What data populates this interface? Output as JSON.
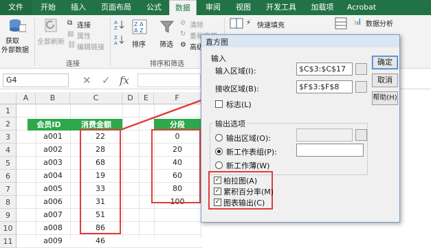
{
  "ribbon": {
    "tabs": [
      "文件",
      "开始",
      "插入",
      "页面布局",
      "公式",
      "数据",
      "审阅",
      "视图",
      "开发工具",
      "加载项",
      "Acrobat"
    ],
    "active_tab": "数据",
    "get_external": "获取\n外部数据",
    "get_external_l1": "获取",
    "get_external_l2": "外部数据",
    "refresh_all": "全部刷新",
    "connections": "连接",
    "properties": "属性",
    "edit_links": "编辑链接",
    "group_connections": "连接",
    "sort": "排序",
    "filter": "筛选",
    "clear": "清除",
    "reapply": "重新应用",
    "advanced": "高级",
    "group_sort_filter": "排序和筛选",
    "flash_fill": "快速填充",
    "data_analysis": "数据分析"
  },
  "formula_bar": {
    "name_box": "G4",
    "cancel_icon": "✕",
    "enter_icon": "✓",
    "fx": "fx"
  },
  "sheet": {
    "columns": [
      "A",
      "B",
      "C",
      "D",
      "E",
      "F",
      "G"
    ],
    "rows": [
      "1",
      "2",
      "3",
      "4",
      "5",
      "6",
      "7",
      "8",
      "9",
      "10",
      "11"
    ],
    "member_header": "会员ID",
    "amount_header": "消费金额",
    "segment_header": "分段",
    "member_ids": [
      "a001",
      "a002",
      "a003",
      "a004",
      "a005",
      "a006",
      "a007",
      "a008",
      "a009"
    ],
    "amounts": [
      "22",
      "28",
      "68",
      "19",
      "33",
      "31",
      "51",
      "86",
      "46"
    ],
    "segments": [
      "0",
      "20",
      "40",
      "60",
      "80",
      "100"
    ]
  },
  "dialog": {
    "title": "直方图",
    "input_section": "输入",
    "input_range_label": "输入区域(I):",
    "input_range_value": "$C$3:$C$17",
    "bin_range_label": "接收区域(B):",
    "bin_range_value": "$F$3:$F$8",
    "labels_label": "标志(L)",
    "output_section": "输出选项",
    "output_range_label": "输出区域(O):",
    "new_sheet_label": "新工作表组(P):",
    "new_workbook_label": "新工作薄(W)",
    "pareto_label": "柏拉图(A)",
    "cumulative_label": "累积百分率(M)",
    "chart_output_label": "图表输出(C)",
    "ok": "确定",
    "cancel": "取消",
    "help": "帮助(H)",
    "checkmark": "✓"
  },
  "colors": {
    "excel_green": "#217346",
    "header_green": "#2ea84a",
    "highlight_red": "#e23b3b"
  }
}
